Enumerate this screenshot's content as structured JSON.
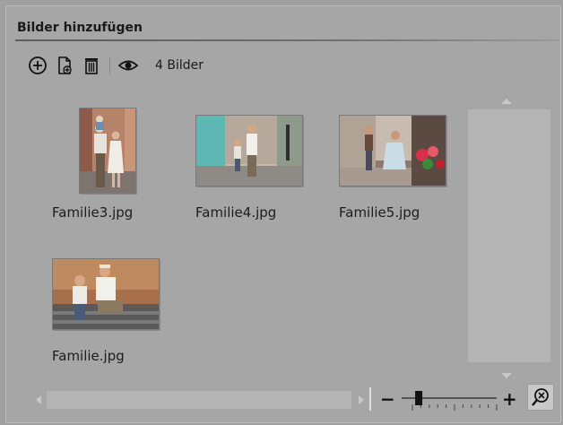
{
  "panel": {
    "title": "Bilder hinzufügen"
  },
  "toolbar": {
    "buttons": [
      {
        "icon": "add-circle-icon"
      },
      {
        "icon": "add-file-icon"
      },
      {
        "icon": "trash-icon"
      },
      {
        "icon": "eye-icon"
      }
    ],
    "count_label": "4 Bilder"
  },
  "images": [
    {
      "filename": "Familie3.jpg"
    },
    {
      "filename": "Familie4.jpg"
    },
    {
      "filename": "Familie5.jpg"
    },
    {
      "filename": "Familie.jpg"
    }
  ],
  "zoom": {
    "minus_label": "−",
    "plus_label": "+",
    "level": 0.18
  },
  "colors": {
    "panel_bg": "#a6a6a6",
    "scroll_track": "#b4b4b4",
    "text": "#1a1a1a"
  }
}
